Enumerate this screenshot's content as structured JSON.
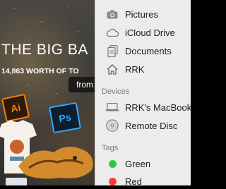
{
  "banner": {
    "headline": "THE BIG BA",
    "subline": "14,863 WORTH OF TO",
    "button_label": "from"
  },
  "sidebar": {
    "favorites": [
      {
        "label": "Pictures",
        "icon": "camera-icon"
      },
      {
        "label": "iCloud Drive",
        "icon": "cloud-icon"
      },
      {
        "label": "Documents",
        "icon": "document-icon"
      },
      {
        "label": "RRK",
        "icon": "home-icon"
      }
    ],
    "devices_heading": "Devices",
    "devices": [
      {
        "label": "RRK's MacBook",
        "icon": "laptop-icon"
      },
      {
        "label": "Remote Disc",
        "icon": "disc-icon"
      }
    ],
    "tags_heading": "Tags",
    "tags": [
      {
        "label": "Green",
        "color": "#2fc744"
      },
      {
        "label": "Red",
        "color": "#fc3d39"
      }
    ]
  }
}
